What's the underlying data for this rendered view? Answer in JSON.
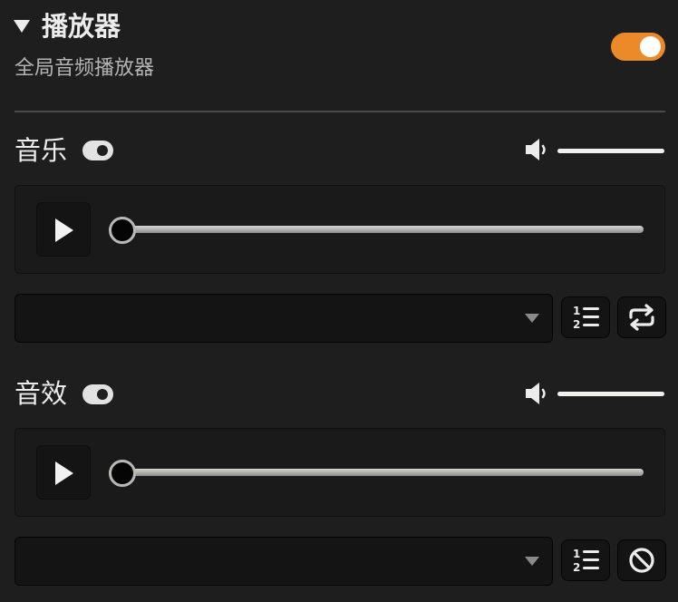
{
  "header": {
    "title": "播放器",
    "subtitle": "全局音频播放器",
    "enabled": true,
    "accent_color": "#ec8a2a"
  },
  "music": {
    "title": "音乐",
    "enabled": true,
    "volume": 1.0,
    "progress": 0.0,
    "selected_track": "",
    "mode_buttons": [
      "playlist-order-icon",
      "repeat-icon"
    ]
  },
  "sfx": {
    "title": "音效",
    "enabled": true,
    "volume": 1.0,
    "progress": 0.0,
    "selected_track": "",
    "mode_buttons": [
      "playlist-order-icon",
      "no-loop-icon"
    ]
  }
}
